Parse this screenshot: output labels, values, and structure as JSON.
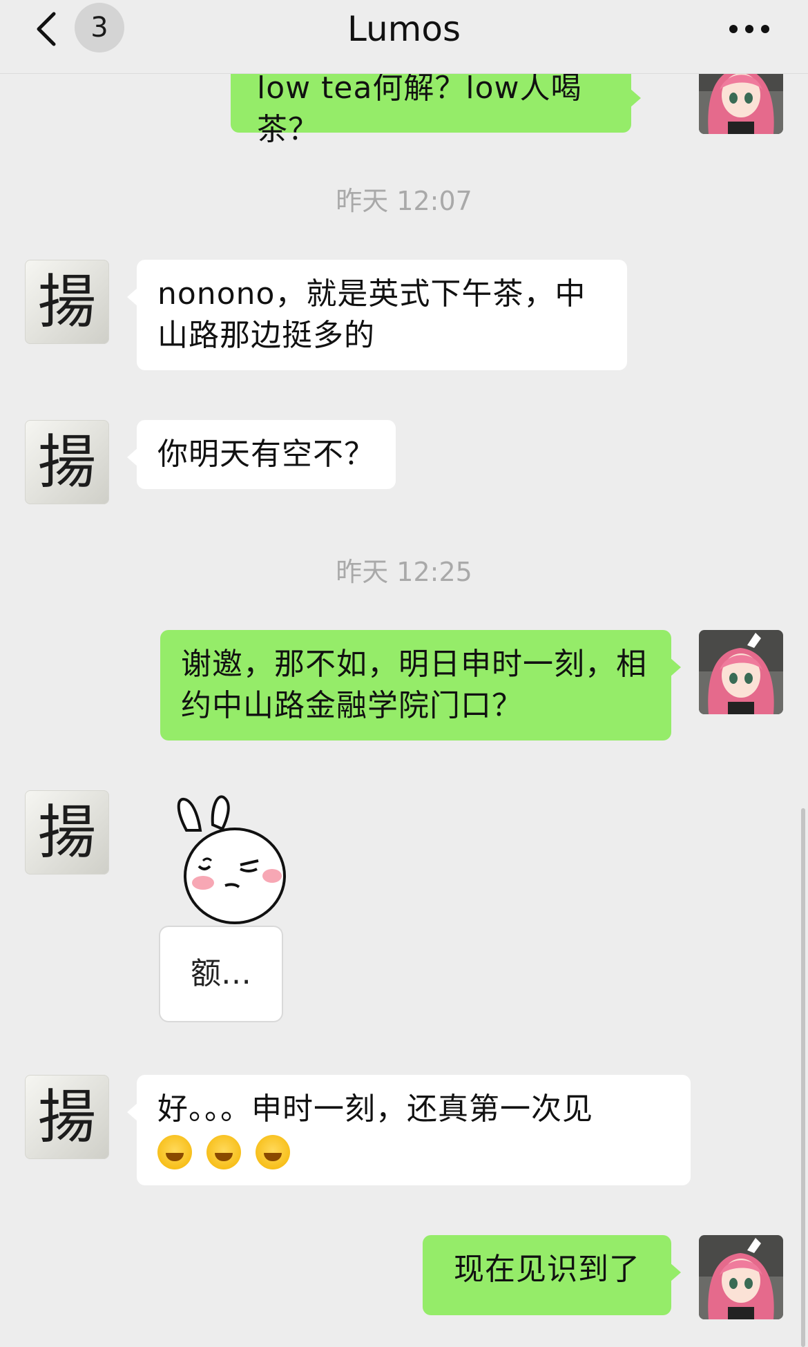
{
  "header": {
    "back_label": "<",
    "badge_count": "3",
    "title": "Lumos",
    "more_label": "•••"
  },
  "messages": {
    "m1": "low tea何解？low人喝茶？",
    "t1": "昨天 12:07",
    "m2": "nonono，就是英式下午茶，中山路那边挺多的",
    "m3": "你明天有空不？",
    "t2": "昨天 12:25",
    "m4": "谢邀，那不如，明日申时一刻，相约中山路金融学院门口？",
    "sticker_text": "额…",
    "m5": "好。。。申时一刻，还真第一次见",
    "m5_emojis": [
      "face-with-tears-of-joy",
      "face-with-tears-of-joy",
      "face-with-tears-of-joy"
    ],
    "m6": "现在见识到了"
  },
  "avatars": {
    "contact_char": "揚"
  },
  "colors": {
    "background": "#ededed",
    "outgoing_bubble": "#95ec69",
    "incoming_bubble": "#ffffff",
    "timestamp": "#a9a9a9"
  }
}
